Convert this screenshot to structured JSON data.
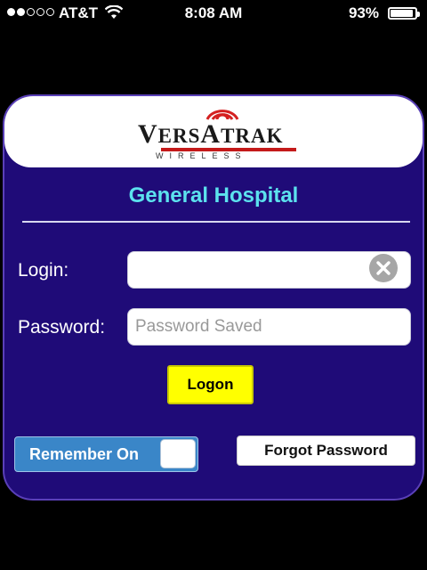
{
  "status_bar": {
    "signal_bars_filled": 2,
    "signal_bars_total": 5,
    "carrier": "AT&T",
    "wifi_icon": "wifi-icon",
    "time": "8:08 AM",
    "battery_percent_label": "93%",
    "battery_level": 0.93
  },
  "logo": {
    "brand_initial_1": "V",
    "brand_rest_1": "ERS",
    "brand_initial_2": "A",
    "brand_rest_2": "TRAK",
    "subtitle": "WIRELESS",
    "wave_color": "#d42020"
  },
  "hospital_name": "General Hospital",
  "login": {
    "label": "Login:",
    "value": "",
    "placeholder": "",
    "clear_icon": "clear-icon"
  },
  "password": {
    "label": "Password:",
    "value": "",
    "placeholder": "Password Saved"
  },
  "logon_button": "Logon",
  "remember_toggle": {
    "label": "Remember On",
    "on": true
  },
  "forgot_button": "Forgot Password",
  "colors": {
    "card_bg": "#1f0b78",
    "hospital_text": "#5ce2ee",
    "logon_bg": "#ffff00",
    "toggle_bg": "#3a86c8"
  }
}
